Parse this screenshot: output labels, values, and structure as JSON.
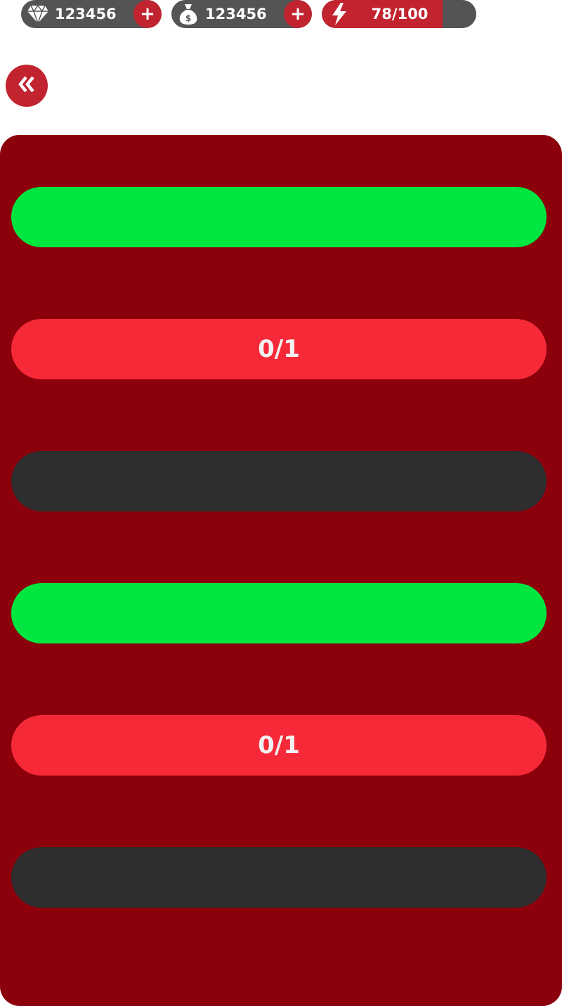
{
  "resources": {
    "gems": {
      "value": "123456",
      "icon": "diamond-icon",
      "plus_label": "+"
    },
    "money": {
      "value": "123456",
      "icon": "money-bag-icon",
      "plus_label": "+"
    },
    "energy": {
      "value": "78/100",
      "icon": "lightning-icon",
      "current": 78,
      "max": 100
    }
  },
  "back_button": {
    "icon": "double-chevron-left-icon"
  },
  "rows": [
    {
      "style": "green",
      "label": ""
    },
    {
      "style": "red",
      "label": "0/1"
    },
    {
      "style": "dark",
      "label": ""
    },
    {
      "style": "green",
      "label": ""
    },
    {
      "style": "red",
      "label": "0/1"
    },
    {
      "style": "dark",
      "label": ""
    }
  ],
  "colors": {
    "accent_red": "#c1232f",
    "panel": "#8b000b",
    "green": "#00e640",
    "red": "#f62939",
    "dark": "#2e2e2e",
    "pill_bg": "#545454"
  }
}
